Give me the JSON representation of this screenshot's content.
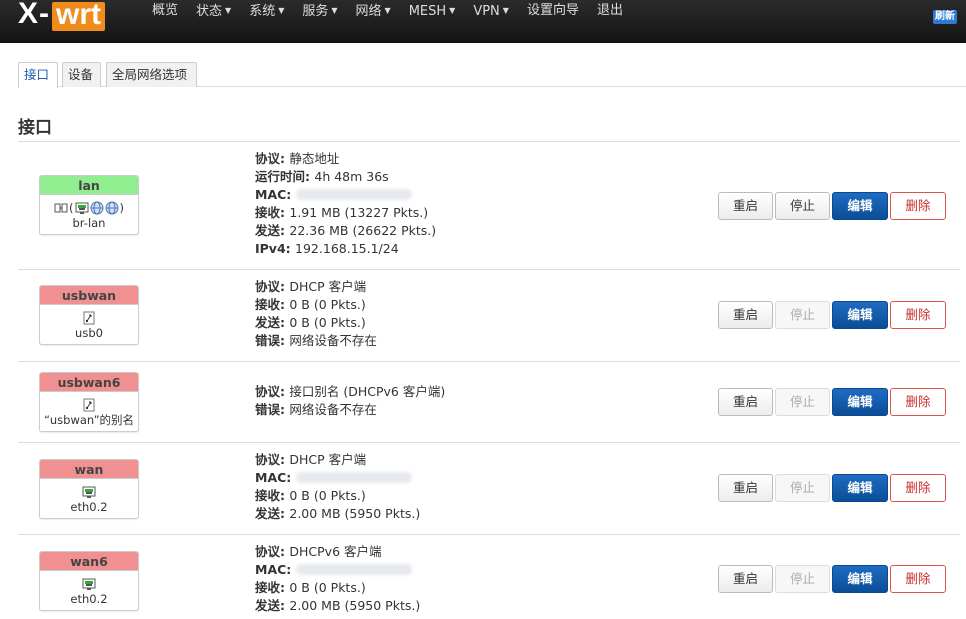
{
  "brand": {
    "x": "X",
    "dash": "-",
    "wrt": "wrt"
  },
  "nav": [
    {
      "label": "概览",
      "caret": false
    },
    {
      "label": "状态",
      "caret": true
    },
    {
      "label": "系统",
      "caret": true
    },
    {
      "label": "服务",
      "caret": true
    },
    {
      "label": "网络",
      "caret": true
    },
    {
      "label": "MESH",
      "caret": true
    },
    {
      "label": "VPN",
      "caret": true
    },
    {
      "label": "设置向导",
      "caret": false
    },
    {
      "label": "退出",
      "caret": false
    }
  ],
  "refresh_label": "刷新",
  "tabs": [
    {
      "label": "接口",
      "active": true
    },
    {
      "label": "设备",
      "active": false
    },
    {
      "label": "全局网络选项",
      "active": false
    }
  ],
  "section_title": "接口",
  "colors": {
    "green_header": "#90ee90",
    "red_header": "#f09090",
    "edit_blue": "#1f6cc2",
    "delete_red": "#d9534f"
  },
  "interfaces": [
    {
      "name": "lan",
      "status_color": "green",
      "device": "br-lan",
      "icons": "bridge",
      "info": [
        {
          "k": "协议",
          "v": "静态地址"
        },
        {
          "k": "运行时间",
          "v": "4h 48m 36s"
        },
        {
          "k": "MAC",
          "v": "",
          "hidden": true
        },
        {
          "k": "接收",
          "v": "1.91 MB (13227 Pkts.)"
        },
        {
          "k": "发送",
          "v": "22.36 MB (26622 Pkts.)"
        },
        {
          "k": "IPv4",
          "v": "192.168.15.1/24"
        }
      ],
      "stop_disabled": false
    },
    {
      "name": "usbwan",
      "status_color": "red",
      "device": "usb0",
      "icons": "usb",
      "info": [
        {
          "k": "协议",
          "v": "DHCP 客户端"
        },
        {
          "k": "接收",
          "v": "0 B (0 Pkts.)"
        },
        {
          "k": "发送",
          "v": "0 B (0 Pkts.)"
        },
        {
          "k": "错误",
          "v": "网络设备不存在"
        }
      ],
      "stop_disabled": true
    },
    {
      "name": "usbwan6",
      "status_color": "red",
      "device": "“usbwan”的别名",
      "icons": "alias",
      "info": [
        {
          "k": "协议",
          "v": "接口别名 (DHCPv6 客户端)"
        },
        {
          "k": "错误",
          "v": "网络设备不存在"
        }
      ],
      "stop_disabled": true
    },
    {
      "name": "wan",
      "status_color": "red",
      "device": "eth0.2",
      "icons": "eth",
      "info": [
        {
          "k": "协议",
          "v": "DHCP 客户端"
        },
        {
          "k": "MAC",
          "v": "",
          "hidden": true
        },
        {
          "k": "接收",
          "v": "0 B (0 Pkts.)"
        },
        {
          "k": "发送",
          "v": "2.00 MB (5950 Pkts.)"
        }
      ],
      "stop_disabled": true
    },
    {
      "name": "wan6",
      "status_color": "red",
      "device": "eth0.2",
      "icons": "eth",
      "info": [
        {
          "k": "协议",
          "v": "DHCPv6 客户端"
        },
        {
          "k": "MAC",
          "v": "",
          "hidden": true
        },
        {
          "k": "接收",
          "v": "0 B (0 Pkts.)"
        },
        {
          "k": "发送",
          "v": "2.00 MB (5950 Pkts.)"
        }
      ],
      "stop_disabled": true
    }
  ],
  "buttons": {
    "restart": "重启",
    "stop": "停止",
    "edit": "编辑",
    "delete": "删除"
  }
}
